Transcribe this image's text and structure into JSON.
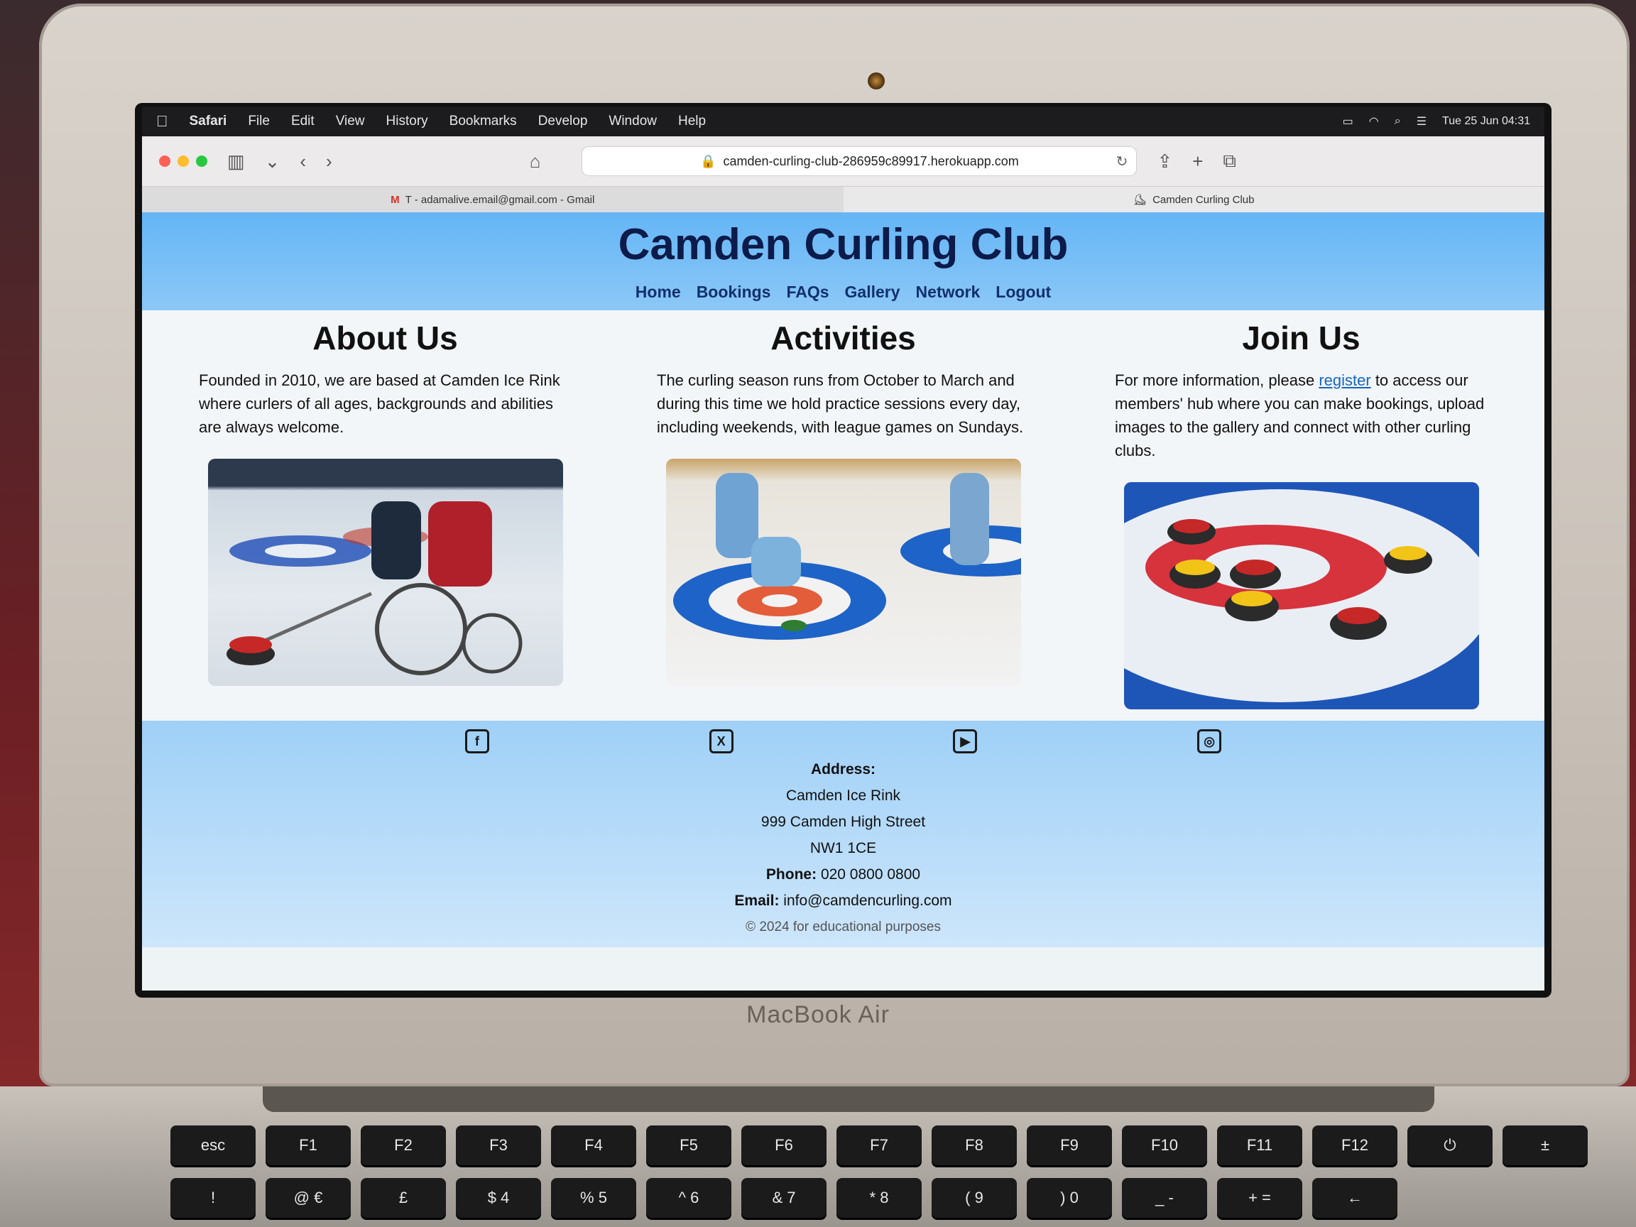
{
  "menubar": {
    "apple": "",
    "items": [
      "Safari",
      "File",
      "Edit",
      "View",
      "History",
      "Bookmarks",
      "Develop",
      "Window",
      "Help"
    ],
    "datetime": "Tue 25 Jun 04:31"
  },
  "browser": {
    "url": "camden-curling-club-286959c89917.herokuapp.com",
    "tabs": [
      {
        "label": "T - adamalive.email@gmail.com - Gmail",
        "icon": "gmail-icon"
      },
      {
        "label": "Camden Curling Club",
        "icon": "curling-icon"
      }
    ]
  },
  "site": {
    "title": "Camden Curling Club",
    "nav": [
      "Home",
      "Bookings",
      "FAQs",
      "Gallery",
      "Network",
      "Logout"
    ],
    "about": {
      "heading": "About Us",
      "text": "Founded in 2010, we are based at Camden Ice Rink where curlers of all ages, backgrounds and abilities are always welcome."
    },
    "activities": {
      "heading": "Activities",
      "text": "The curling season runs from October to March and during this time we hold practice sessions every day, including weekends, with league games on Sundays."
    },
    "join": {
      "heading": "Join Us",
      "text_before": "For more information, please ",
      "link": "register",
      "text_after": " to access our members' hub where you can make bookings, upload images to the gallery and connect with other curling clubs."
    },
    "footer": {
      "socials": [
        "facebook-icon",
        "x-icon",
        "youtube-icon",
        "instagram-icon"
      ],
      "address_label": "Address:",
      "address_lines": [
        "Camden Ice Rink",
        "999 Camden High Street",
        "NW1 1CE"
      ],
      "phone_label": "Phone:",
      "phone": "020 0800 0800",
      "email_label": "Email:",
      "email": "info@camdencurling.com",
      "copyright": "© 2024 for educational purposes"
    }
  },
  "laptop": {
    "brand": "MacBook Air",
    "keys": [
      "esc",
      "F1",
      "F2",
      "F3",
      "F4",
      "F5",
      "F6",
      "F7",
      "F8",
      "F9",
      "F10",
      "F11",
      "F12",
      "⏻",
      "±",
      "!",
      "@ €",
      "£",
      "$ 4",
      "% 5",
      "^ 6",
      "& 7",
      "* 8",
      "( 9",
      ") 0",
      "_ -",
      "+ =",
      "←"
    ]
  }
}
